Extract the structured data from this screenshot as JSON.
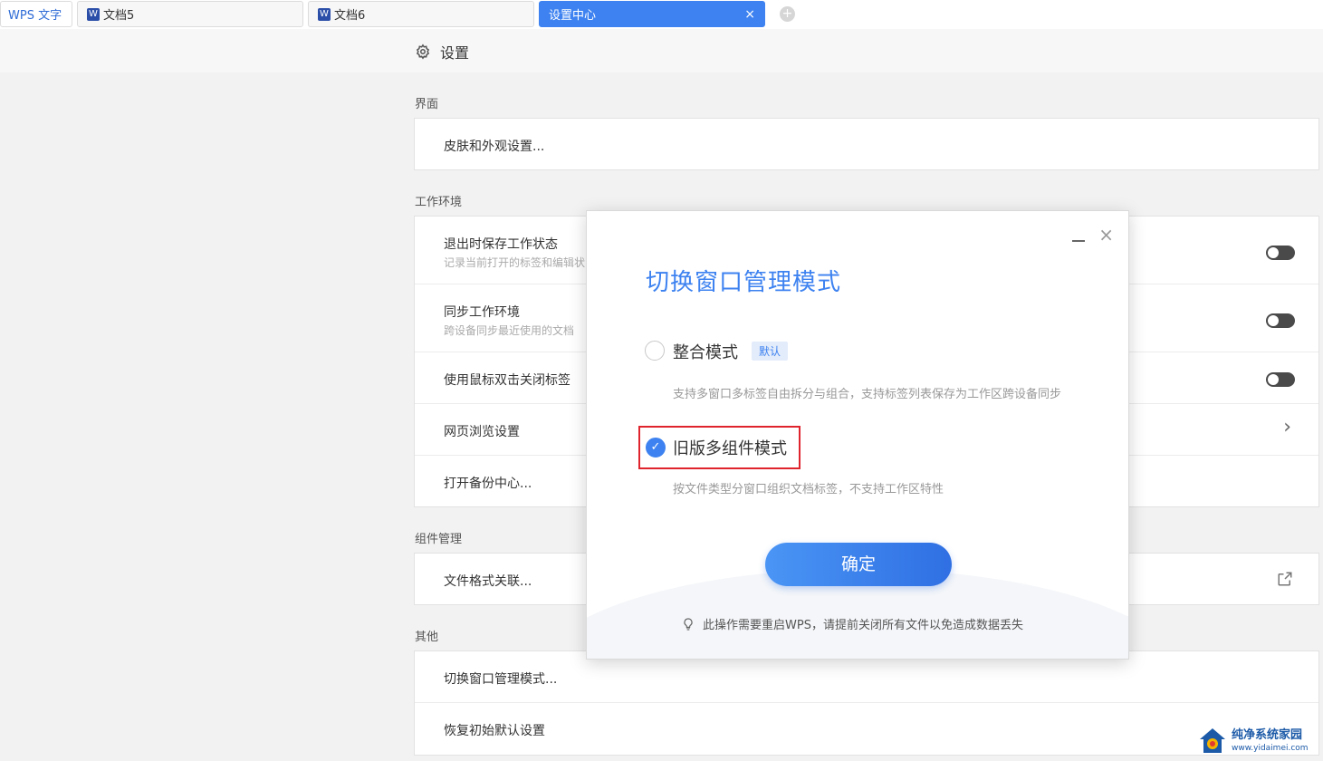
{
  "tabs": {
    "home": "WPS 文字",
    "doc5": "文档5",
    "doc6": "文档6",
    "active": "设置中心",
    "doc_icon_glyph": "W",
    "close_glyph": "×",
    "add_glyph": "+"
  },
  "header": {
    "title": "设置"
  },
  "sections": {
    "interface": {
      "label": "界面",
      "rows": [
        {
          "title": "皮肤和外观设置..."
        }
      ]
    },
    "workspace": {
      "label": "工作环境",
      "rows": [
        {
          "title": "退出时保存工作状态",
          "sub": "记录当前打开的标签和编辑状",
          "control": "toggle"
        },
        {
          "title": "同步工作环境",
          "sub": "跨设备同步最近使用的文档",
          "control": "toggle"
        },
        {
          "title": "使用鼠标双击关闭标签",
          "control": "toggle"
        },
        {
          "title": "网页浏览设置",
          "control": "chevron",
          "chevron_glyph": "›"
        },
        {
          "title": "打开备份中心..."
        }
      ]
    },
    "components": {
      "label": "组件管理",
      "rows": [
        {
          "title": "文件格式关联...",
          "control": "external-link-icon"
        }
      ]
    },
    "other": {
      "label": "其他",
      "rows": [
        {
          "title": "切换窗口管理模式..."
        },
        {
          "title": "恢复初始默认设置"
        }
      ]
    }
  },
  "dialog": {
    "title": "切换窗口管理模式",
    "close_glyph": "×",
    "options": [
      {
        "label": "整合模式",
        "badge": "默认",
        "desc": "支持多窗口多标签自由拆分与组合，支持标签列表保存为工作区跨设备同步",
        "checked": false
      },
      {
        "label": "旧版多组件模式",
        "desc": "按文件类型分窗口组织文档标签，不支持工作区特性",
        "checked": true,
        "check_glyph": "✓"
      }
    ],
    "confirm": "确定",
    "tip": "此操作需要重启WPS，请提前关闭所有文件以免造成数据丢失"
  },
  "watermark": {
    "name": "纯净系统家园",
    "url": "www.yidaimei.com"
  },
  "colors": {
    "accent": "#3d82f0",
    "highlight_border": "#e0242d",
    "toggle_off": "#4a4a4a",
    "page_bg": "#f2f2f2"
  }
}
